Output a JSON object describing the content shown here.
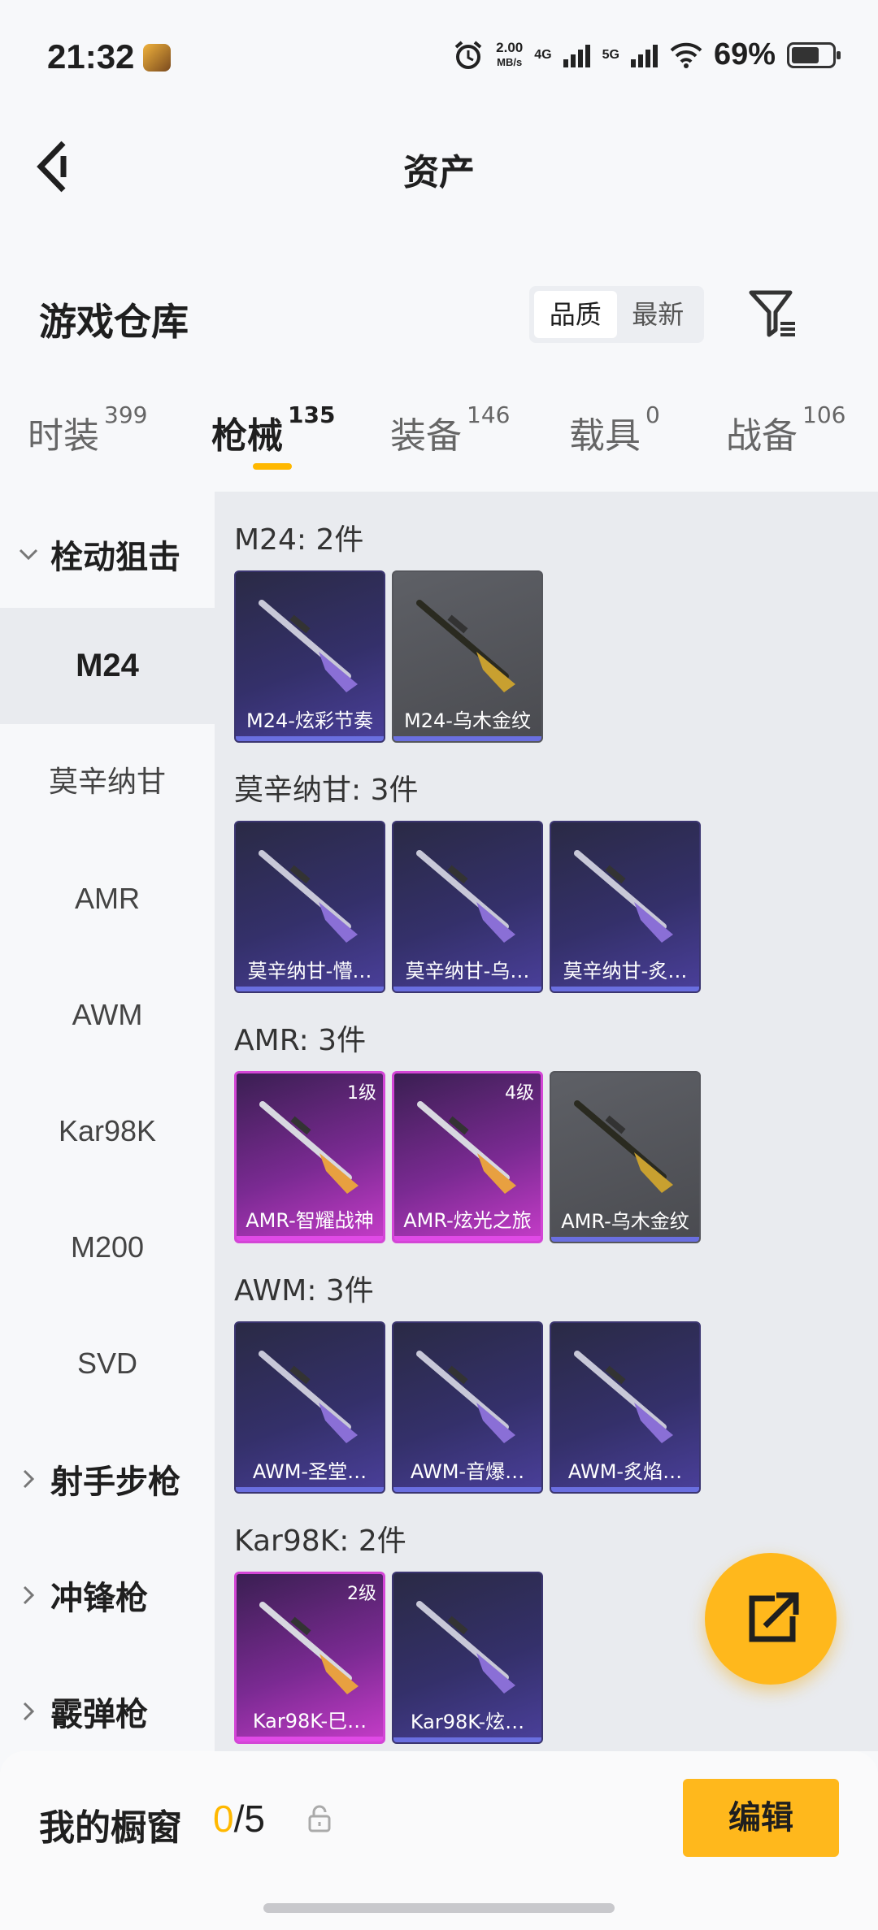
{
  "status": {
    "time": "21:32",
    "net_speed_top": "2.00",
    "net_speed_unit": "MB/s",
    "sig1": "4G",
    "sig2": "5G",
    "battery": "69%"
  },
  "nav": {
    "title": "资产"
  },
  "warehouse": {
    "label": "游戏仓库",
    "sort_quality": "品质",
    "sort_latest": "最新"
  },
  "tabs": [
    {
      "label": "时装",
      "count": "399"
    },
    {
      "label": "枪械",
      "count": "135"
    },
    {
      "label": "装备",
      "count": "146"
    },
    {
      "label": "载具",
      "count": "0"
    },
    {
      "label": "战备",
      "count": "106"
    }
  ],
  "sidebar": {
    "group1": "栓动狙击",
    "items": [
      "M24",
      "莫辛纳甘",
      "AMR",
      "AWM",
      "Kar98K",
      "M200",
      "SVD"
    ],
    "group2": "射手步枪",
    "group3": "冲锋枪",
    "group4": "霰弹枪"
  },
  "sections": [
    {
      "title": "M24: 2件",
      "cards": [
        {
          "name": "M24-炫彩节奏",
          "style": "blue",
          "level": ""
        },
        {
          "name": "M24-乌木金纹",
          "style": "gray",
          "level": ""
        }
      ]
    },
    {
      "title": "莫辛纳甘: 3件",
      "cards": [
        {
          "name": "莫辛纳甘-懵…",
          "style": "blue",
          "level": ""
        },
        {
          "name": "莫辛纳甘-乌…",
          "style": "blue",
          "level": ""
        },
        {
          "name": "莫辛纳甘-炙…",
          "style": "blue",
          "level": ""
        }
      ]
    },
    {
      "title": "AMR: 3件",
      "cards": [
        {
          "name": "AMR-智耀战神",
          "style": "pink",
          "level": "1级"
        },
        {
          "name": "AMR-炫光之旅",
          "style": "pink",
          "level": "4级"
        },
        {
          "name": "AMR-乌木金纹",
          "style": "gray",
          "level": ""
        }
      ]
    },
    {
      "title": "AWM: 3件",
      "cards": [
        {
          "name": "AWM-圣堂…",
          "style": "blue",
          "level": ""
        },
        {
          "name": "AWM-音爆…",
          "style": "blue",
          "level": ""
        },
        {
          "name": "AWM-炙焰…",
          "style": "blue",
          "level": ""
        }
      ]
    },
    {
      "title": "Kar98K: 2件",
      "cards": [
        {
          "name": "Kar98K-巳…",
          "style": "pink",
          "level": "2级"
        },
        {
          "name": "Kar98K-炫…",
          "style": "blue",
          "level": ""
        }
      ]
    }
  ],
  "showcase": {
    "label": "我的橱窗",
    "current": "0",
    "total": "/5",
    "edit": "编辑"
  }
}
